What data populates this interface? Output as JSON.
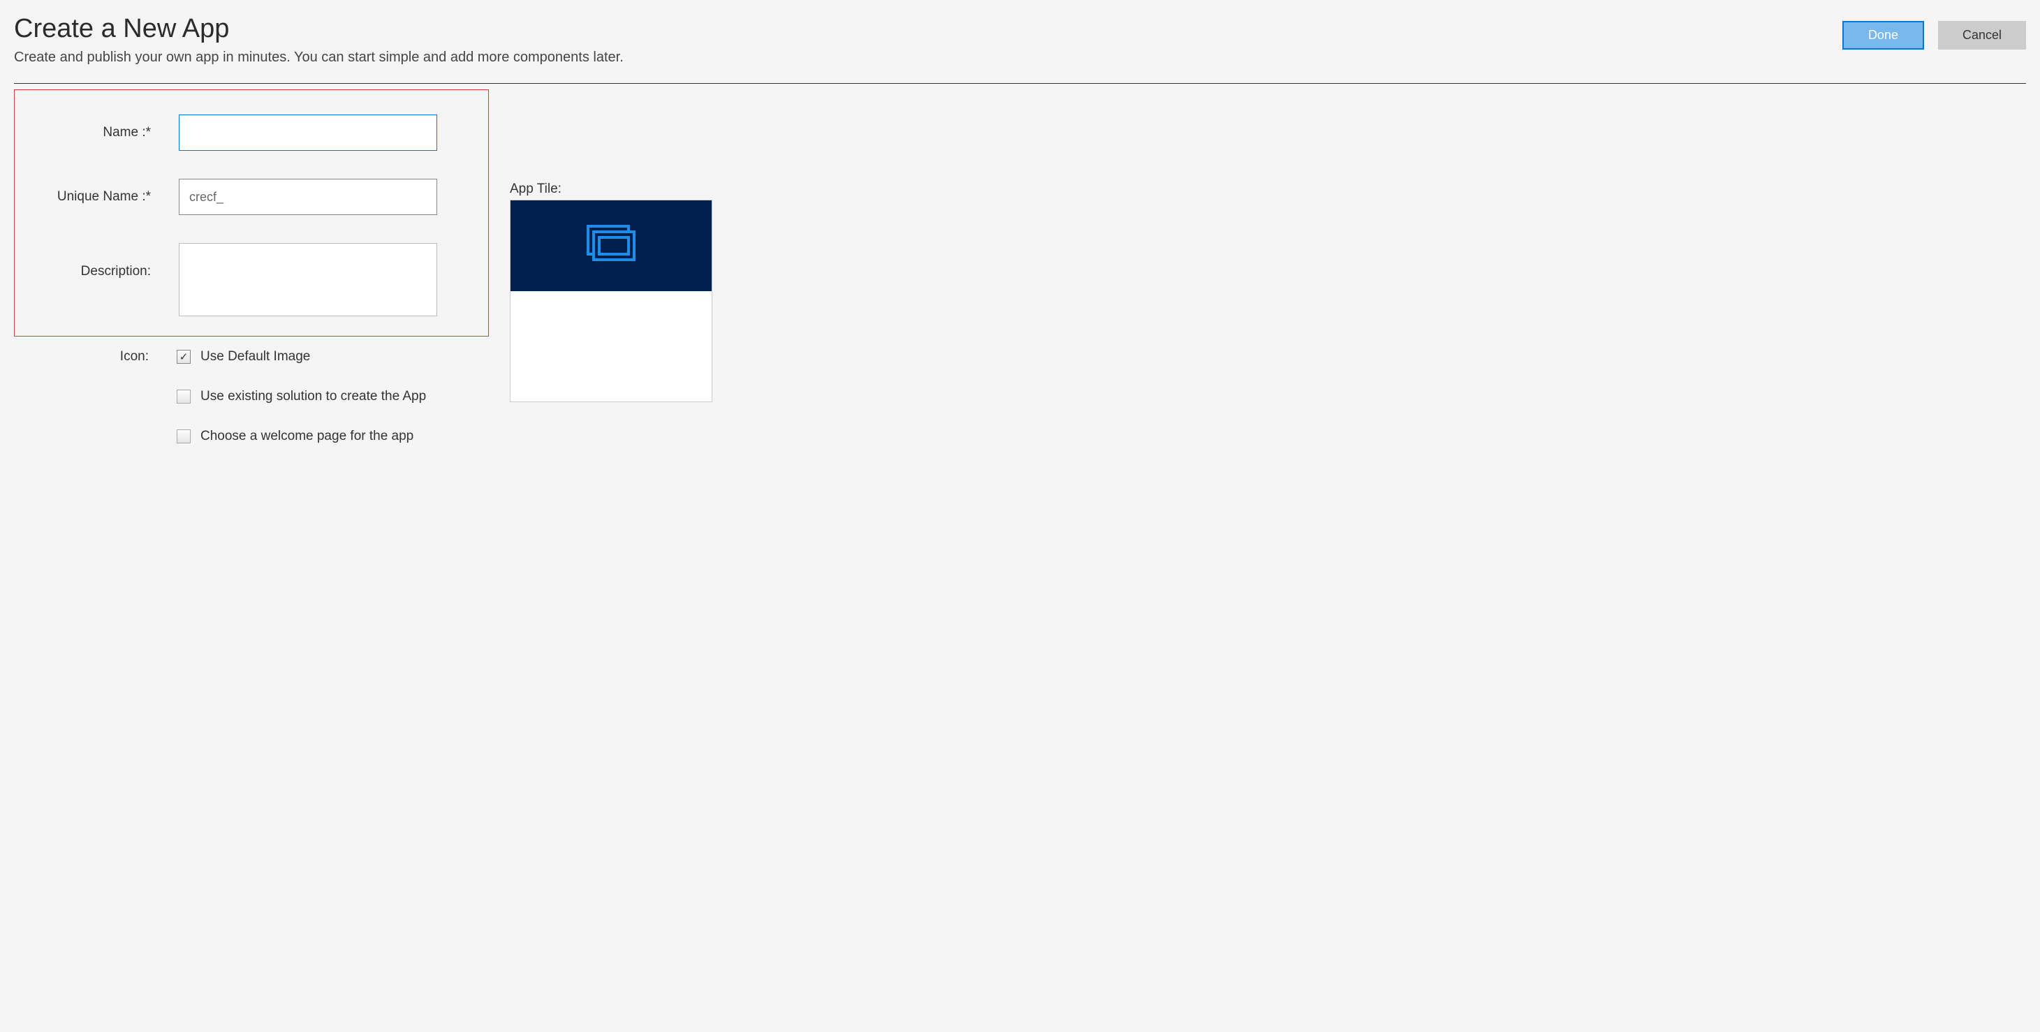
{
  "header": {
    "title": "Create a New App",
    "subtitle": "Create and publish your own app in minutes. You can start simple and add more components later.",
    "done_label": "Done",
    "cancel_label": "Cancel"
  },
  "form": {
    "name_label": "Name :*",
    "name_value": "",
    "unique_name_label": "Unique Name :*",
    "unique_name_value": "crecf_",
    "description_label": "Description:",
    "description_value": "",
    "icon_label": "Icon:",
    "use_default_image_label": "Use Default Image",
    "use_default_image_checked": true,
    "use_existing_solution_label": "Use existing solution to create the App",
    "use_existing_solution_checked": false,
    "choose_welcome_label": "Choose a welcome page for the app",
    "choose_welcome_checked": false
  },
  "tile": {
    "label": "App Tile:"
  }
}
